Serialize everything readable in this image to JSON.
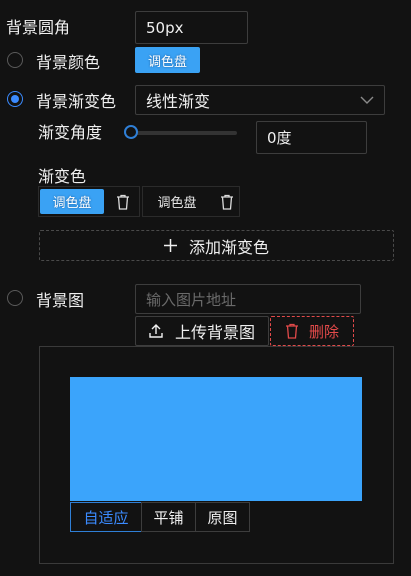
{
  "bg_radius": {
    "label": "背景圆角",
    "value": "50px"
  },
  "bg_color": {
    "label": "背景颜色",
    "picker_label": "调色盘"
  },
  "bg_gradient": {
    "label": "背景渐变色",
    "type_value": "线性渐变",
    "angle_label": "渐变角度",
    "angle_value": "0度",
    "angle_slider_value": 0,
    "colors_label": "渐变色",
    "color_pickers": [
      {
        "picker_label": "调色盘",
        "style": "active"
      },
      {
        "picker_label": "调色盘",
        "style": "inactive"
      }
    ],
    "add_label": "添加渐变色"
  },
  "bg_image": {
    "label": "背景图",
    "url_placeholder": "输入图片地址",
    "upload_label": "上传背景图",
    "delete_label": "删除",
    "preview_color": "#3ba4fb",
    "fit_modes": [
      "自适应",
      "平铺",
      "原图"
    ],
    "active_fit_mode": "自适应"
  },
  "colors": {
    "accent": "#3b8bff",
    "picker_blue": "#3aa2f4",
    "danger": "#e24a4a"
  },
  "icons": [
    "trash-icon",
    "chevron-down-icon",
    "plus-icon",
    "upload-icon"
  ]
}
